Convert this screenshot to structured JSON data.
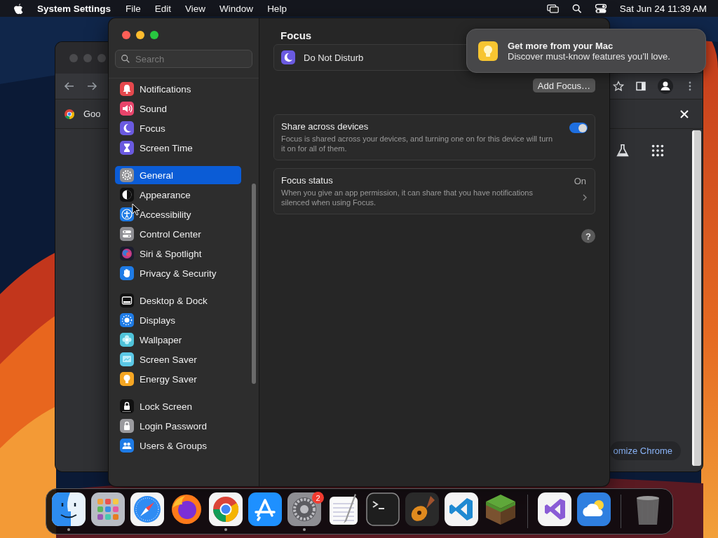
{
  "menu_bar": {
    "app": "System Settings",
    "menus": [
      "File",
      "Edit",
      "View",
      "Window",
      "Help"
    ],
    "clock": "Sat Jun 24  11:39 AM"
  },
  "browser_window": {
    "tab_title": "Goo",
    "customize_button": "omize Chrome"
  },
  "settings_window": {
    "search": {
      "placeholder": "Search"
    },
    "sidebar": {
      "groups": [
        [
          {
            "label": "Notifications",
            "kind": "bell",
            "selected": false
          },
          {
            "label": "Sound",
            "kind": "speaker",
            "selected": false
          },
          {
            "label": "Focus",
            "kind": "moon",
            "selected": false
          },
          {
            "label": "Screen Time",
            "kind": "hourglass",
            "selected": false
          }
        ],
        [
          {
            "label": "General",
            "kind": "gear",
            "selected": true
          },
          {
            "label": "Appearance",
            "kind": "contrast",
            "selected": false
          },
          {
            "label": "Accessibility",
            "kind": "accessibility",
            "selected": false
          },
          {
            "label": "Control Center",
            "kind": "switches",
            "selected": false
          },
          {
            "label": "Siri & Spotlight",
            "kind": "orb",
            "selected": false
          },
          {
            "label": "Privacy & Security",
            "kind": "hand",
            "selected": false
          }
        ],
        [
          {
            "label": "Desktop & Dock",
            "kind": "dock",
            "selected": false
          },
          {
            "label": "Displays",
            "kind": "sun",
            "selected": false
          },
          {
            "label": "Wallpaper",
            "kind": "flower",
            "selected": false
          },
          {
            "label": "Screen Saver",
            "kind": "screen",
            "selected": false
          },
          {
            "label": "Energy Saver",
            "kind": "bulb",
            "selected": false
          }
        ],
        [
          {
            "label": "Lock Screen",
            "kind": "lockscreen",
            "selected": false
          },
          {
            "label": "Login Password",
            "kind": "lock",
            "selected": false
          },
          {
            "label": "Users & Groups",
            "kind": "people",
            "selected": false
          }
        ]
      ]
    },
    "title": "Focus",
    "focus_modes": [
      {
        "name": "Do Not Disturb"
      }
    ],
    "add_button": "Add Focus…",
    "options": [
      {
        "kind": "toggle",
        "title": "Share across devices",
        "description": "Focus is shared across your devices, and turning one on for this device will turn it on for all of them.",
        "on": true
      },
      {
        "kind": "link",
        "title": "Focus status",
        "description": "When you give an app permission, it can share that you have notifications silenced when using Focus.",
        "value": "On"
      }
    ],
    "help_button": "?"
  },
  "notification": {
    "title": "Get more from your Mac",
    "body": "Discover must-know features you’ll love."
  },
  "dock": {
    "items": [
      {
        "kind": "finder",
        "running": true
      },
      {
        "kind": "launchpad",
        "running": false
      },
      {
        "kind": "safari",
        "running": false
      },
      {
        "kind": "firefox",
        "running": false
      },
      {
        "kind": "chrome",
        "running": true
      },
      {
        "kind": "appstore",
        "running": false
      },
      {
        "kind": "settings",
        "running": true,
        "badge": "2"
      },
      {
        "kind": "textedit",
        "running": false
      },
      {
        "kind": "terminal",
        "running": false
      },
      {
        "kind": "guitar",
        "running": false
      },
      {
        "kind": "vscode",
        "running": false
      },
      {
        "kind": "block",
        "running": false
      },
      {
        "kind": "separator"
      },
      {
        "kind": "vstudio",
        "running": false
      },
      {
        "kind": "weather",
        "running": false
      },
      {
        "kind": "separator"
      },
      {
        "kind": "trash",
        "running": false
      }
    ]
  }
}
